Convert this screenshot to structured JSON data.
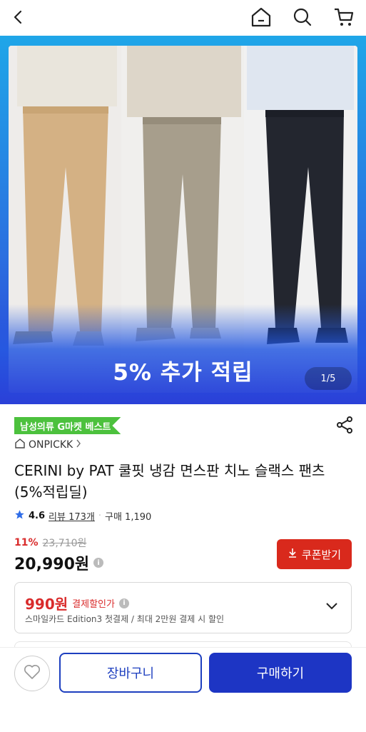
{
  "header": {
    "back_icon": "chevron-left-icon",
    "home_icon": "home-icon",
    "search_icon": "search-icon",
    "cart_icon": "cart-icon"
  },
  "hero": {
    "promo_text": "5% 추가 적립",
    "pager": "1/5"
  },
  "product": {
    "badge": "남성의류 G마켓 베스트",
    "shop": "ONPICKK",
    "title": "CERINI by PAT 쿨핏 냉감 면스판 치노 슬랙스 팬츠(5%적립딜)",
    "rating": "4.6",
    "reviews": "리뷰 173개",
    "purchases": "구매 1,190",
    "discount": "11%",
    "original_price": "23,710원",
    "price": "20,990원",
    "coupon_label": "쿠폰받기"
  },
  "payment_card": {
    "amount": "990원",
    "label": "결제할인가",
    "subtext": "스마일카드 Edition3 첫결제 / 최대 2만원 결제 시 할인"
  },
  "bottom": {
    "cart_label": "장바구니",
    "buy_label": "구매하기"
  },
  "colors": {
    "accent_blue": "#1d35c4",
    "discount_red": "#d92b2b",
    "badge_green": "#4cc13d",
    "coupon_red": "#d9291c"
  }
}
